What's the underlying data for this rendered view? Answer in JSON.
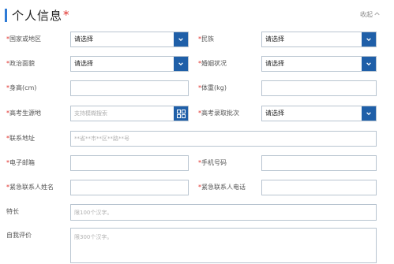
{
  "header": {
    "title": "个人信息",
    "required_mark": "*",
    "collapse_label": "收起",
    "collapse_icon": "chevron-up-icon"
  },
  "fields": {
    "region": {
      "label": "国家或地区",
      "required": "*",
      "value": "请选择"
    },
    "ethnicity": {
      "label": "民族",
      "required": "*",
      "value": "请选择"
    },
    "political": {
      "label": "政治面貌",
      "required": "*",
      "value": "请选择"
    },
    "marital": {
      "label": "婚姻状况",
      "required": "*",
      "value": "请选择"
    },
    "height": {
      "label": "身高(cm)",
      "required": "*",
      "value": ""
    },
    "weight": {
      "label": "体重(kg)",
      "required": "*",
      "value": ""
    },
    "exam_origin": {
      "label": "高考生源地",
      "required": "*",
      "placeholder": "支持模糊搜索"
    },
    "exam_batch": {
      "label": "高考录取批次",
      "required": "*",
      "value": "请选择"
    },
    "address": {
      "label": "联系地址",
      "required": "*",
      "placeholder": "**省**市**区**路**号"
    },
    "email": {
      "label": "电子邮箱",
      "required": "*",
      "value": ""
    },
    "phone": {
      "label": "手机号码",
      "required": "*",
      "value": ""
    },
    "emergency_name": {
      "label": "紧急联系人姓名",
      "required": "*",
      "value": ""
    },
    "emergency_phone": {
      "label": "紧急联系人电话",
      "required": "*",
      "value": ""
    },
    "specialty": {
      "label": "特长",
      "placeholder": "限100个汉字。"
    },
    "self_eval": {
      "label": "自我评价",
      "placeholder": "限300个汉字。"
    }
  },
  "colors": {
    "accent": "#2e7bd6",
    "dropdown_button": "#1f5fa8",
    "required": "#e0302c",
    "border": "#b8c4d0"
  }
}
